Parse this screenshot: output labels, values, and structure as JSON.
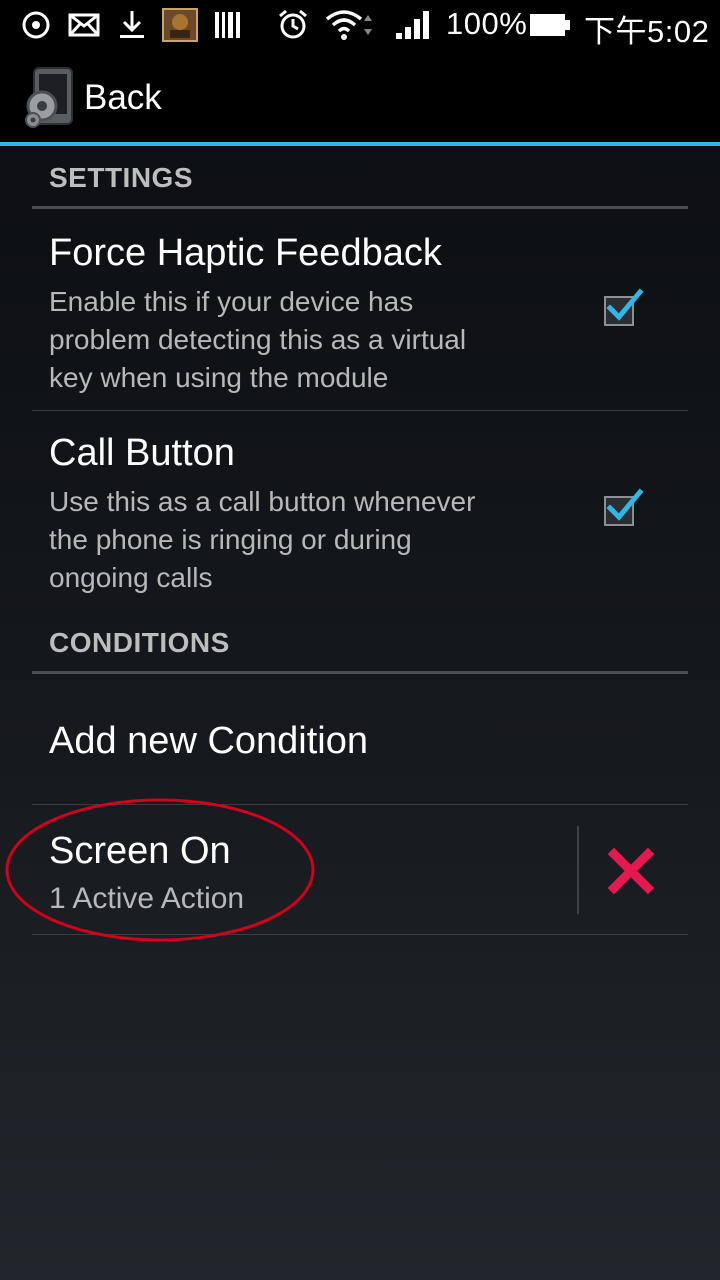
{
  "status_bar": {
    "battery_percent": "100%",
    "time": "下午5:02"
  },
  "action_bar": {
    "back_label": "Back"
  },
  "settings_section": {
    "header": "SETTINGS",
    "items": [
      {
        "title": "Force Haptic Feedback",
        "summary_lines": [
          "Enable this if your device has",
          "problem detecting this as a virtual",
          "key when using the module"
        ],
        "checked": true
      },
      {
        "title": "Call Button",
        "summary_lines": [
          "Use this as a call button whenever",
          "the phone is ringing or during",
          "ongoing calls"
        ],
        "checked": true
      }
    ]
  },
  "conditions_section": {
    "header": "CONDITIONS",
    "add_label": "Add new Condition",
    "conditions": [
      {
        "title": "Screen On",
        "subtitle": "1 Active Action"
      }
    ]
  },
  "colors": {
    "accent": "#33b5e5",
    "delete": "#e5194f",
    "annotation": "#d3001c"
  }
}
